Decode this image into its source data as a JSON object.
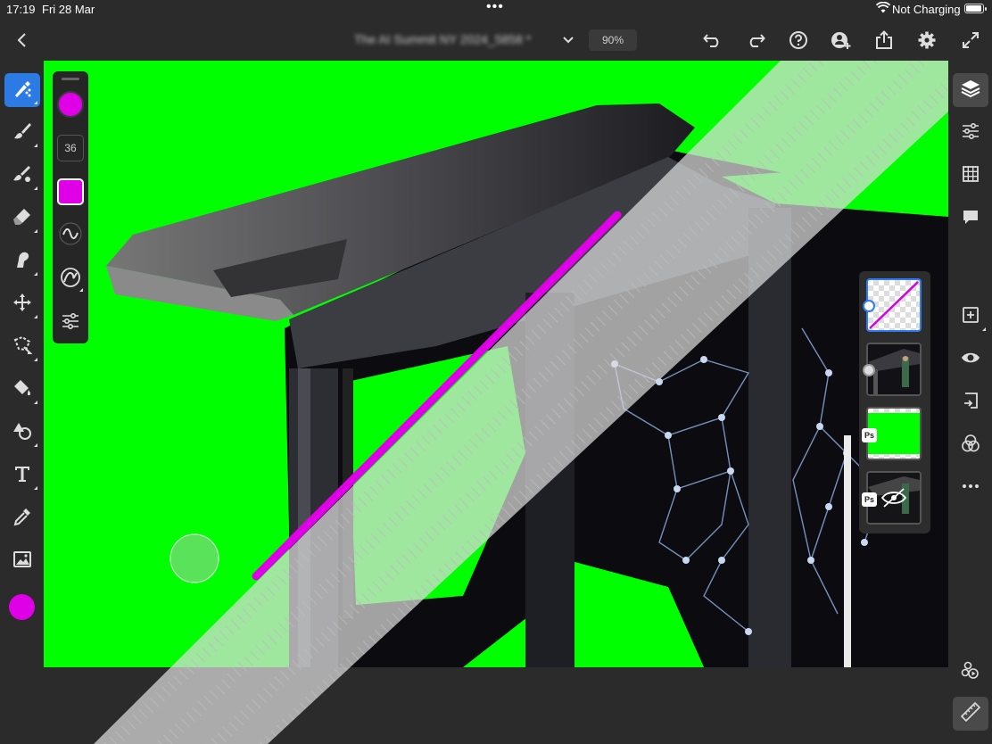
{
  "status_bar": {
    "time": "17:19",
    "date": "Fri 28 Mar",
    "multitask_dots": "•••",
    "charging_status": "Not Charging"
  },
  "top_bar": {
    "document_title": "The AI Summit NY 2024_5858 *",
    "zoom_level": "90%"
  },
  "brush_panel": {
    "brush_size": "36",
    "brush_color": "#e000e8"
  },
  "colors": {
    "canvas_green": "#00ff00",
    "brush_magenta": "#e000e8",
    "accent_blue": "#2c7be5",
    "foreground_swatch": "#e000e8"
  },
  "left_tools": [
    "brush-select-icon",
    "brush-icon",
    "healing-brush-icon",
    "eraser-icon",
    "smudge-icon",
    "move-icon",
    "lasso-icon",
    "paint-bucket-icon",
    "shape-icon",
    "type-icon",
    "eyedropper-icon",
    "place-image-icon"
  ],
  "right_tools": [
    "layers-icon",
    "adjustments-icon",
    "grid-icon",
    "comments-icon",
    "add-layer-icon",
    "visibility-icon",
    "mask-icon",
    "blend-icon",
    "more-icon",
    "capture-icon",
    "ruler-icon"
  ],
  "layers": [
    {
      "name": "magenta stroke layer",
      "selected": true,
      "visible": true
    },
    {
      "name": "stage photo layer",
      "selected": false,
      "visible": true
    },
    {
      "name": "green background layer",
      "selected": false,
      "visible": true,
      "badge": "Ps"
    },
    {
      "name": "hidden photo layer",
      "selected": false,
      "visible": false,
      "badge": "Ps"
    }
  ]
}
